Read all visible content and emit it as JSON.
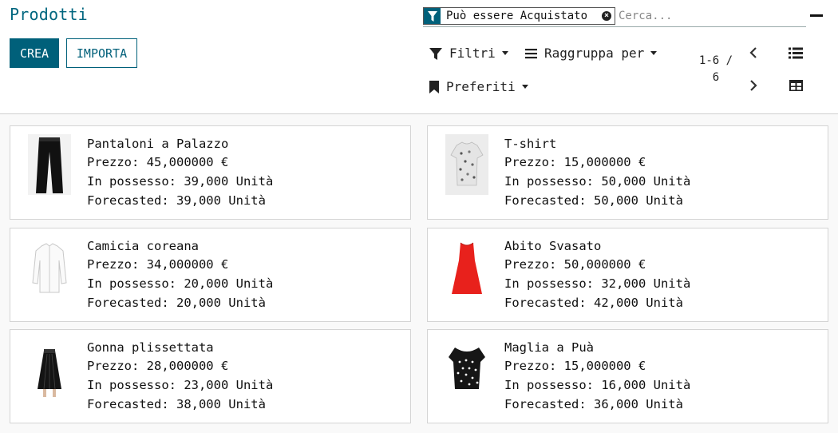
{
  "header": {
    "title": "Prodotti",
    "create_label": "CREA",
    "import_label": "IMPORTA"
  },
  "search": {
    "facet_label": "Può essere Acquistato",
    "placeholder": "Cerca..."
  },
  "menus": {
    "filters": "Filtri",
    "groupby": "Raggruppa per",
    "favorites": "Preferiti"
  },
  "pager": {
    "value": "1-6 / 6"
  },
  "products": [
    {
      "name": "Pantaloni a Palazzo",
      "price": "Prezzo: 45,000000 €",
      "on_hand": "In possesso: 39,000 Unità",
      "forecasted": "Forecasted: 39,000 Unità",
      "image": "palazzo-pants"
    },
    {
      "name": "T-shirt",
      "price": "Prezzo: 15,000000 €",
      "on_hand": "In possesso: 50,000 Unità",
      "forecasted": "Forecasted: 50,000 Unità",
      "image": "floral-tshirt"
    },
    {
      "name": "Camicia coreana",
      "price": "Prezzo: 34,000000 €",
      "on_hand": "In possesso: 20,000 Unità",
      "forecasted": "Forecasted: 20,000 Unità",
      "image": "white-shirt"
    },
    {
      "name": "Abito Svasato",
      "price": "Prezzo: 50,000000 €",
      "on_hand": "In possesso: 32,000 Unità",
      "forecasted": "Forecasted: 42,000 Unità",
      "image": "red-dress"
    },
    {
      "name": "Gonna plissettata",
      "price": "Prezzo: 28,000000 €",
      "on_hand": "In possesso: 23,000 Unità",
      "forecasted": "Forecasted: 38,000 Unità",
      "image": "pleated-skirt"
    },
    {
      "name": "Maglia a Puà",
      "price": "Prezzo: 15,000000 €",
      "on_hand": "In possesso: 16,000 Unità",
      "forecasted": "Forecasted: 36,000 Unità",
      "image": "polka-top"
    }
  ],
  "colors": {
    "brand": "#00607a",
    "title": "#00667f"
  }
}
